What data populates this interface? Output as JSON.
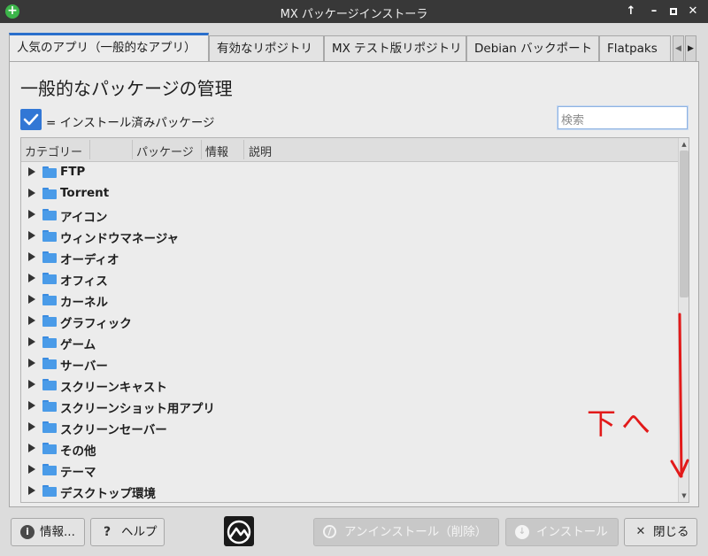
{
  "window": {
    "title": "MX パッケージインストーラ",
    "buttons": [
      "up-arrow",
      "minimize",
      "maximize",
      "close"
    ]
  },
  "tabs": [
    {
      "label": "人気のアプリ（一般的なアプリ）",
      "active": true
    },
    {
      "label": "有効なリポジトリ",
      "active": false
    },
    {
      "label": "MX テスト版リポジトリ",
      "active": false
    },
    {
      "label": "Debian バックポート",
      "active": false
    },
    {
      "label": "Flatpaks",
      "active": false
    }
  ],
  "main": {
    "title": "一般的なパッケージの管理",
    "legend_label": "= インストール済みパッケージ",
    "search_placeholder": "検索"
  },
  "tree": {
    "columns": [
      "カテゴリー",
      "パッケージ",
      "情報",
      "説明"
    ],
    "categories": [
      "FTP",
      "Torrent",
      "アイコン",
      "ウィンドウマネージャ",
      "オーディオ",
      "オフィス",
      "カーネル",
      "グラフィック",
      "ゲーム",
      "サーバー",
      "スクリーンキャスト",
      "スクリーンショット用アプリ",
      "スクリーンセーバー",
      "その他",
      "テーマ",
      "デスクトップ環境"
    ]
  },
  "annotation": {
    "text": "下へ",
    "color": "#e21a1a"
  },
  "buttons": {
    "about": "情報...",
    "help": "ヘルプ",
    "uninstall": "アンインストール（削除）",
    "install": "インストール",
    "close": "閉じる"
  },
  "colors": {
    "accent": "#3277d5",
    "folder": "#4a9be8",
    "titlebar": "#383838"
  }
}
